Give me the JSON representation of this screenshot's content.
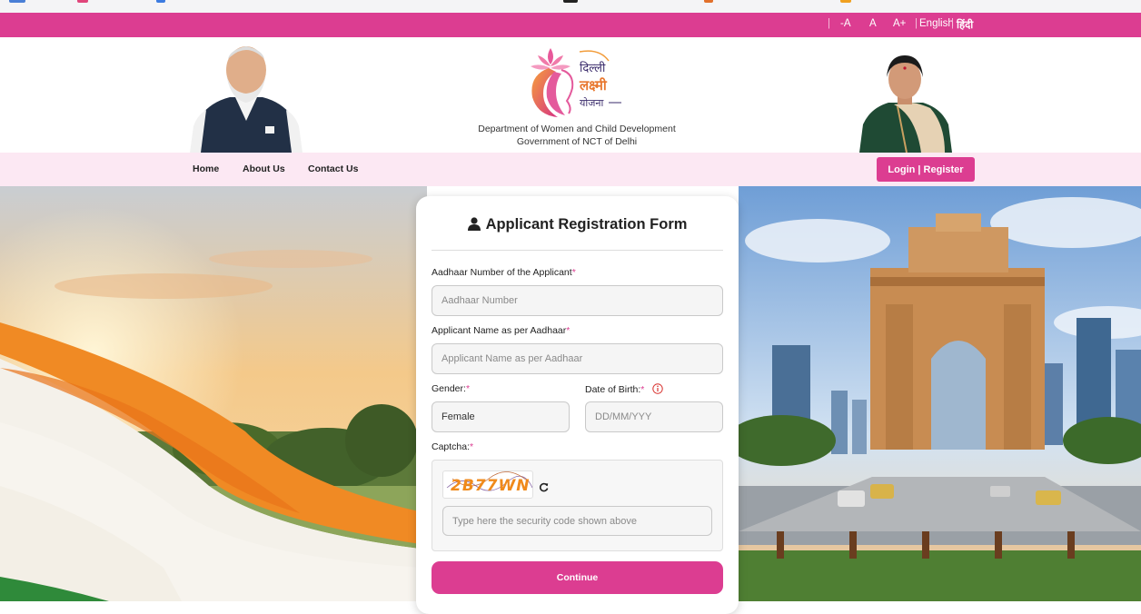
{
  "topbar": {
    "font_decrease": "-A",
    "font_normal": "A",
    "font_increase": "A+",
    "lang_english": "English",
    "lang_hindi": "हिंदी",
    "lang_separator": "|"
  },
  "header": {
    "logo_text_line1": "दिल्ली",
    "logo_text_line2": "लक्ष्मी",
    "logo_text_line3": "योजना",
    "department": "Department of Women and Child Development",
    "government": "Government of NCT of Delhi"
  },
  "nav": {
    "items": [
      "Home",
      "About Us",
      "Contact Us"
    ],
    "login_register": "Login | Register"
  },
  "form": {
    "title": "Applicant Registration Form",
    "aadhaar_label": "Aadhaar Number of the Applicant",
    "aadhaar_placeholder": "Aadhaar Number",
    "name_label": "Applicant Name as per Aadhaar",
    "name_placeholder": "Applicant Name as per Aadhaar",
    "gender_label": "Gender:",
    "gender_value": "Female",
    "dob_label": "Date of Birth:",
    "dob_placeholder": "DD/MM/YYY",
    "captcha_label": "Captcha:",
    "captcha_code": "2B77WN",
    "captcha_placeholder": "Type here the security code shown above",
    "required_mark": "*",
    "continue_label": "Continue"
  },
  "colors": {
    "brand_pink": "#dc3d91",
    "nav_background": "#fce8f3",
    "captcha_text": "#f08a1b"
  },
  "icons": {
    "title_icon": "user-icon",
    "dob_info": "info-circle-icon",
    "captcha_refresh": "refresh-icon"
  }
}
